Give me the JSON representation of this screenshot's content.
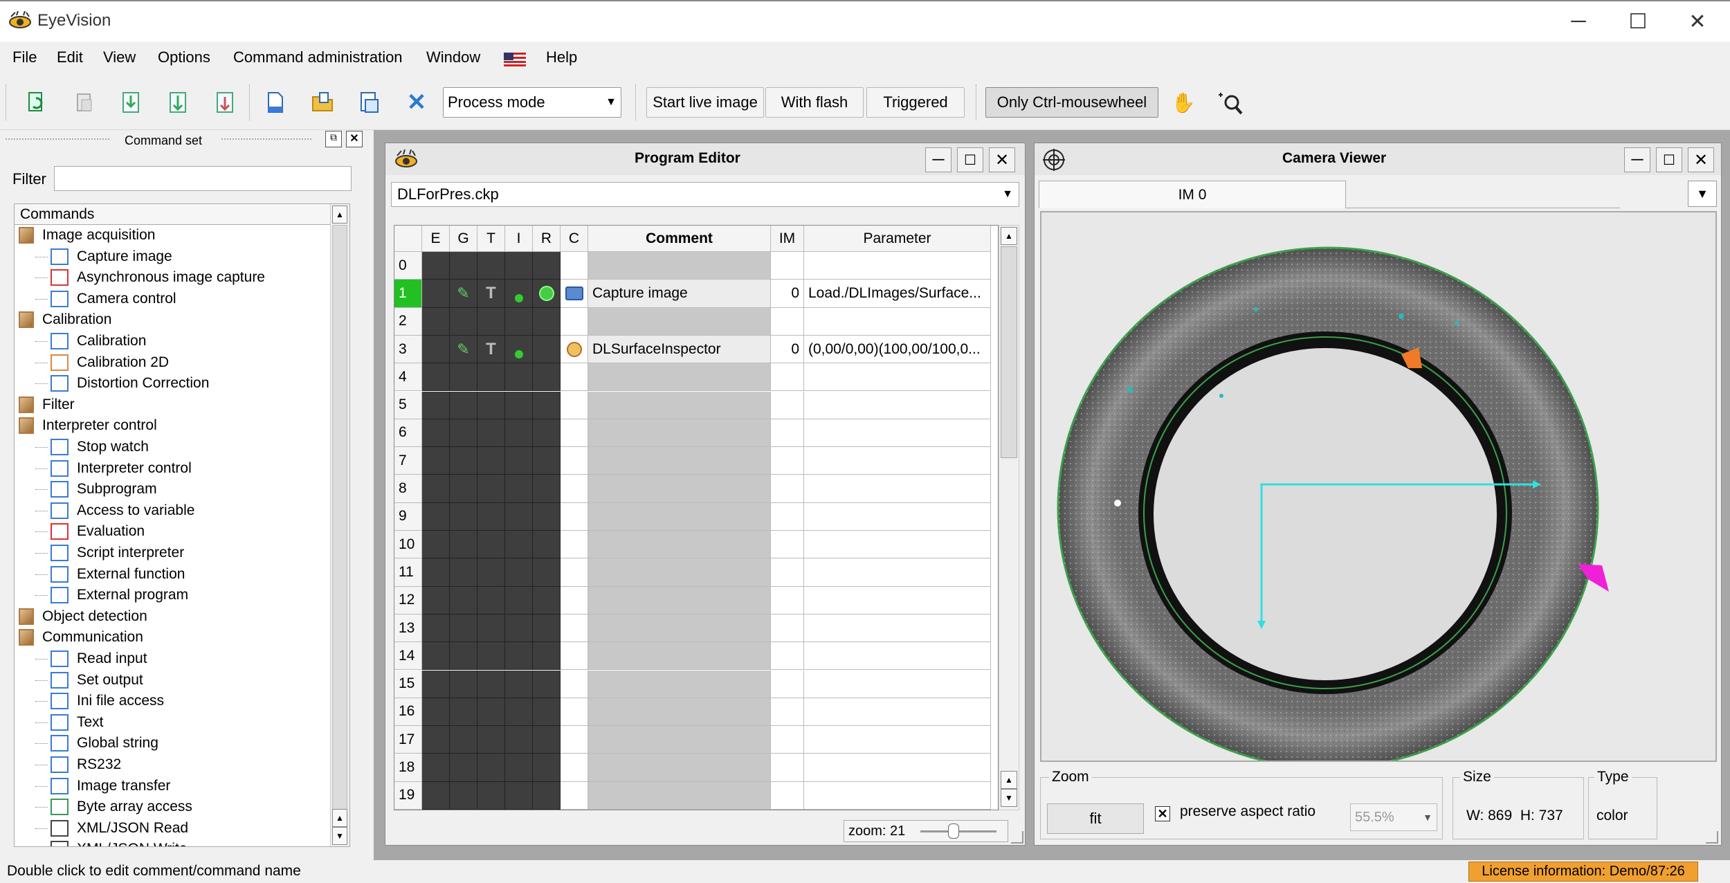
{
  "app": {
    "title": "EyeVision"
  },
  "menu": [
    "File",
    "Edit",
    "View",
    "Options",
    "Command administration",
    "Window",
    "Help"
  ],
  "toolbar": {
    "mode_select": "Process mode",
    "start_live": "Start live image",
    "with_flash": "With flash",
    "triggered": "Triggered",
    "only_ctrl": "Only Ctrl-mousewheel"
  },
  "command_set": {
    "title": "Command set",
    "filter_label": "Filter",
    "filter_value": "",
    "header": "Commands",
    "items": [
      {
        "label": "Image acquisition",
        "level": 0,
        "icon": "category-icon"
      },
      {
        "label": "Capture image",
        "level": 1,
        "icon": "camera-icon"
      },
      {
        "label": "Asynchronous image capture",
        "level": 1,
        "icon": "async-capture-icon"
      },
      {
        "label": "Camera control",
        "level": 1,
        "icon": "camera-control-icon"
      },
      {
        "label": "Calibration",
        "level": 0,
        "icon": "category-icon"
      },
      {
        "label": "Calibration",
        "level": 1,
        "icon": "calibration-icon"
      },
      {
        "label": "Calibration 2D",
        "level": 1,
        "icon": "calibration-2d-icon"
      },
      {
        "label": "Distortion Correction",
        "level": 1,
        "icon": "distortion-icon"
      },
      {
        "label": "Filter",
        "level": 0,
        "icon": "category-icon"
      },
      {
        "label": "Interpreter control",
        "level": 0,
        "icon": "category-icon"
      },
      {
        "label": "Stop watch",
        "level": 1,
        "icon": "stopwatch-icon"
      },
      {
        "label": "Interpreter control",
        "level": 1,
        "icon": "interpreter-icon"
      },
      {
        "label": "Subprogram",
        "level": 1,
        "icon": "subprogram-icon"
      },
      {
        "label": "Access to variable",
        "level": 1,
        "icon": "variable-icon"
      },
      {
        "label": "Evaluation",
        "level": 1,
        "icon": "evaluation-icon"
      },
      {
        "label": "Script interpreter",
        "level": 1,
        "icon": "script-icon"
      },
      {
        "label": "External function",
        "level": 1,
        "icon": "function-icon"
      },
      {
        "label": "External program",
        "level": 1,
        "icon": "program-icon"
      },
      {
        "label": "Object detection",
        "level": 0,
        "icon": "category-icon"
      },
      {
        "label": "Communication",
        "level": 0,
        "icon": "category-icon"
      },
      {
        "label": "Read input",
        "level": 1,
        "icon": "read-input-icon"
      },
      {
        "label": "Set output",
        "level": 1,
        "icon": "set-output-icon"
      },
      {
        "label": "Ini file access",
        "level": 1,
        "icon": "ini-icon"
      },
      {
        "label": "Text",
        "level": 1,
        "icon": "text-icon"
      },
      {
        "label": "Global string",
        "level": 1,
        "icon": "global-string-icon"
      },
      {
        "label": "RS232",
        "level": 1,
        "icon": "rs232-icon"
      },
      {
        "label": "Image transfer",
        "level": 1,
        "icon": "image-transfer-icon"
      },
      {
        "label": "Byte array access",
        "level": 1,
        "icon": "byte-array-icon"
      },
      {
        "label": "XML/JSON Read",
        "level": 1,
        "icon": "xml-read-icon"
      },
      {
        "label": "XML/JSON Write",
        "level": 1,
        "icon": "xml-write-icon"
      }
    ]
  },
  "program_editor": {
    "title": "Program Editor",
    "file": "DLForPres.ckp",
    "columns": [
      "E",
      "G",
      "T",
      "I",
      "R",
      "C",
      "Comment",
      "IM",
      "Parameter"
    ],
    "rows": [
      {
        "n": "0",
        "comment": "",
        "im": "",
        "param": "",
        "active": false,
        "cmd": false
      },
      {
        "n": "1",
        "comment": "Capture image",
        "im": "0",
        "param": "Load./DLImages/Surface...",
        "active": true,
        "cmd": true,
        "kind": "camera"
      },
      {
        "n": "2",
        "comment": "",
        "im": "",
        "param": "",
        "active": false,
        "cmd": false
      },
      {
        "n": "3",
        "comment": "DLSurfaceInspector",
        "im": "0",
        "param": "(0,00/0,00)(100,00/100,0...",
        "active": false,
        "cmd": true,
        "kind": "inspector"
      },
      {
        "n": "4",
        "comment": "",
        "im": "",
        "param": ""
      },
      {
        "n": "5",
        "comment": "",
        "im": "",
        "param": ""
      },
      {
        "n": "6",
        "comment": "",
        "im": "",
        "param": ""
      },
      {
        "n": "7",
        "comment": "",
        "im": "",
        "param": ""
      },
      {
        "n": "8",
        "comment": "",
        "im": "",
        "param": ""
      },
      {
        "n": "9",
        "comment": "",
        "im": "",
        "param": ""
      },
      {
        "n": "10",
        "comment": "",
        "im": "",
        "param": ""
      },
      {
        "n": "11",
        "comment": "",
        "im": "",
        "param": ""
      },
      {
        "n": "12",
        "comment": "",
        "im": "",
        "param": ""
      },
      {
        "n": "13",
        "comment": "",
        "im": "",
        "param": ""
      },
      {
        "n": "14",
        "comment": "",
        "im": "",
        "param": ""
      },
      {
        "n": "15",
        "comment": "",
        "im": "",
        "param": ""
      },
      {
        "n": "16",
        "comment": "",
        "im": "",
        "param": ""
      },
      {
        "n": "17",
        "comment": "",
        "im": "",
        "param": ""
      },
      {
        "n": "18",
        "comment": "",
        "im": "",
        "param": ""
      },
      {
        "n": "19",
        "comment": "",
        "im": "",
        "param": ""
      }
    ],
    "zoom_label": "zoom: 21"
  },
  "camera_viewer": {
    "title": "Camera Viewer",
    "tab": "IM 0",
    "zoom_group": "Zoom",
    "fit": "fit",
    "preserve": "preserve aspect ratio",
    "zoom_value": "55.5%",
    "size_group": "Size",
    "size_value": "W: 869  H: 737",
    "type_group": "Type",
    "type_value": "color"
  },
  "status": {
    "hint": "Double click to edit comment/command name",
    "license": "License information: Demo/87:26"
  },
  "colors": {
    "active_row": "#22c022",
    "license_bg": "#f0a030",
    "mdi_bg": "#a7a7a7",
    "dark_col": "#3e3e3e"
  }
}
